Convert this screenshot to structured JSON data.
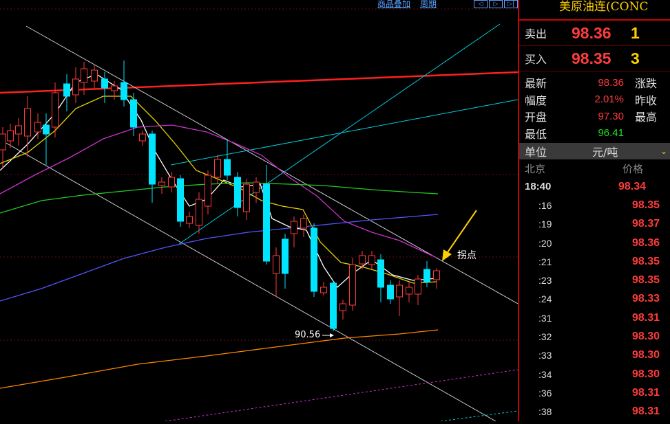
{
  "toolbar": {
    "link1": "商品叠加",
    "link2": "周期",
    "btn_left": "◁",
    "btn_right": "▷",
    "btn_end": "▷|"
  },
  "panel": {
    "title": "美原油连(CONC",
    "sell_label": "卖出",
    "sell_price": "98.36",
    "sell_vol": "1",
    "buy_label": "买入",
    "buy_price": "98.35",
    "buy_vol": "3",
    "stats": [
      {
        "k": "最新",
        "v": "98.36",
        "k2": "涨跌",
        "color": "#ff3b3b"
      },
      {
        "k": "幅度",
        "v": "2.01%",
        "k2": "昨收",
        "color": "#ff3b3b"
      },
      {
        "k": "开盘",
        "v": "97.30",
        "k2": "最高",
        "color": "#ff3b3b"
      },
      {
        "k": "最低",
        "v": "96.41",
        "k2": "",
        "color": "#22dd22"
      }
    ],
    "unit_label": "单位",
    "unit_value": "元/吨",
    "col_time": "北京",
    "col_price": "价格",
    "ticks": [
      {
        "t": "18:40",
        "p": "98.34"
      },
      {
        "t": ":16",
        "p": "98.35"
      },
      {
        "t": ":19",
        "p": "98.37"
      },
      {
        "t": ":20",
        "p": "98.36"
      },
      {
        "t": ":21",
        "p": "98.35"
      },
      {
        "t": ":23",
        "p": "98.35"
      },
      {
        "t": ":24",
        "p": "98.33"
      },
      {
        "t": ":31",
        "p": "98.31"
      },
      {
        "t": ":32",
        "p": "98.30"
      },
      {
        "t": ":33",
        "p": "98.30"
      },
      {
        "t": ":34",
        "p": "98.30"
      },
      {
        "t": ":36",
        "p": "98.31"
      },
      {
        "t": ":38",
        "p": "98.31"
      }
    ]
  },
  "chart_data": {
    "type": "candlestick",
    "low_label": "90.56",
    "annotation": "拐点",
    "colors": {
      "up": "#ff3b3b",
      "down": "#00e5ff",
      "ma5": "#ffffff",
      "ma10": "#e6d200",
      "ma20": "#cc33cc",
      "ma60": "#22cc22",
      "ma120": "#5555ff",
      "ma250": "#ff8800",
      "trend": "#ffffff",
      "channel": "#00d0e0",
      "level": "#ff2020"
    }
  }
}
